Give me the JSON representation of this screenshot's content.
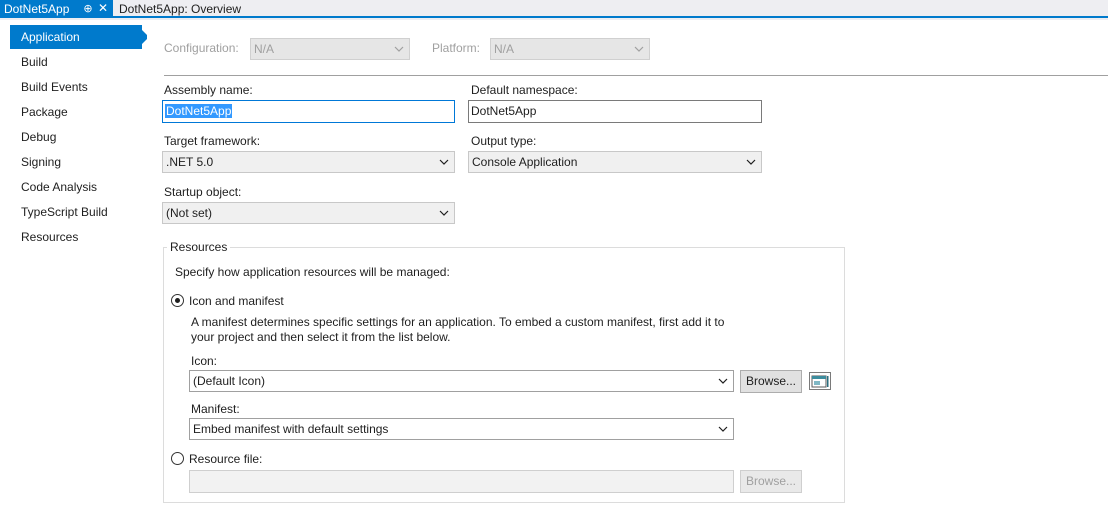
{
  "tabs": {
    "active": "DotNet5App",
    "active_pin": "⊕",
    "active_close": "✕",
    "inactive": "DotNet5App: Overview"
  },
  "sidebar": {
    "items": [
      {
        "label": "Application",
        "active": true
      },
      {
        "label": "Build"
      },
      {
        "label": "Build Events"
      },
      {
        "label": "Package"
      },
      {
        "label": "Debug"
      },
      {
        "label": "Signing"
      },
      {
        "label": "Code Analysis"
      },
      {
        "label": "TypeScript Build"
      },
      {
        "label": "Resources"
      }
    ]
  },
  "config": {
    "configuration_label": "Configuration:",
    "configuration_value": "N/A",
    "platform_label": "Platform:",
    "platform_value": "N/A"
  },
  "form": {
    "assembly_name_label": "Assembly name:",
    "assembly_name_value": "DotNet5App",
    "default_namespace_label": "Default namespace:",
    "default_namespace_value": "DotNet5App",
    "target_framework_label": "Target framework:",
    "target_framework_value": ".NET 5.0",
    "output_type_label": "Output type:",
    "output_type_value": "Console Application",
    "startup_object_label": "Startup object:",
    "startup_object_value": "(Not set)"
  },
  "resources": {
    "group_title": "Resources",
    "description": "Specify how application resources will be managed:",
    "icon_manifest_label": "Icon and manifest",
    "icon_manifest_selected": true,
    "manifest_help_line1": "A manifest determines specific settings for an application. To embed a custom manifest, first add it to",
    "manifest_help_line2": "your project and then select it from the list below.",
    "icon_label": "Icon:",
    "icon_value": "(Default Icon)",
    "browse_label": "Browse...",
    "manifest_label": "Manifest:",
    "manifest_value": "Embed manifest with default settings",
    "resource_file_label": "Resource file:",
    "resource_file_value": "",
    "browse_disabled_label": "Browse..."
  },
  "colors": {
    "accent": "#007acc",
    "selection": "#3399ff"
  }
}
